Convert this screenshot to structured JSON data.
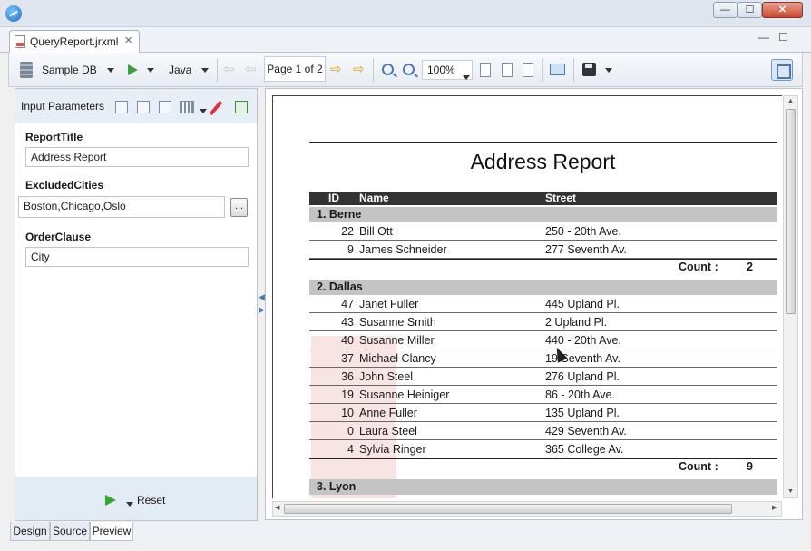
{
  "editor": {
    "tab_label": "QueryReport.jrxml",
    "close_glyph": "✕",
    "minimize_glyph": "—",
    "maximize_glyph": "☐"
  },
  "toolbar": {
    "datasource": "Sample DB",
    "language": "Java",
    "page_indicator": "Page 1 of 2",
    "zoom": "100%",
    "first_glyph": "⇦",
    "prev_glyph": "⇦",
    "next_glyph": "⇨",
    "last_glyph": "⇨"
  },
  "params": {
    "title": "Input Parameters",
    "fields": [
      {
        "label": "ReportTitle",
        "value": "Address Report"
      },
      {
        "label": "ExcludedCities",
        "value": "Boston,Chicago,Oslo"
      },
      {
        "label": "OrderClause",
        "value": "City"
      }
    ],
    "browse_label": "...",
    "reset_label": "Reset"
  },
  "report": {
    "title": "Address Report",
    "columns": [
      "ID",
      "Name",
      "Street"
    ],
    "count_label": "Count :",
    "groups": [
      {
        "name": "1. Berne",
        "rows": [
          {
            "id": "22",
            "name": "Bill Ott",
            "street": "250 - 20th Ave."
          },
          {
            "id": "9",
            "name": "James Schneider",
            "street": "277 Seventh Av."
          }
        ],
        "count": "2"
      },
      {
        "name": "2. Dallas",
        "rows": [
          {
            "id": "47",
            "name": "Janet Fuller",
            "street": "445 Upland Pl."
          },
          {
            "id": "43",
            "name": "Susanne Smith",
            "street": "2 Upland Pl."
          },
          {
            "id": "40",
            "name": "Susanne Miller",
            "street": "440 - 20th Ave."
          },
          {
            "id": "37",
            "name": "Michael Clancy",
            "street": "19 Seventh Av."
          },
          {
            "id": "36",
            "name": "John Steel",
            "street": "276 Upland Pl."
          },
          {
            "id": "19",
            "name": "Susanne Heiniger",
            "street": "86 - 20th Ave."
          },
          {
            "id": "10",
            "name": "Anne Fuller",
            "street": "135 Upland Pl."
          },
          {
            "id": "0",
            "name": "Laura Steel",
            "street": "429 Seventh Av."
          },
          {
            "id": "4",
            "name": "Sylvia Ringer",
            "street": "365 College Av."
          }
        ],
        "count": "9"
      },
      {
        "name": "3. Lyon",
        "rows": [],
        "count": ""
      }
    ]
  },
  "bottom_tabs": [
    "Design",
    "Source",
    "Preview"
  ],
  "colors": {
    "run_green": "#3aa33a",
    "accent_blue": "#4b79b3",
    "group_gray": "#c4c4c4",
    "header_dark": "#333333"
  }
}
